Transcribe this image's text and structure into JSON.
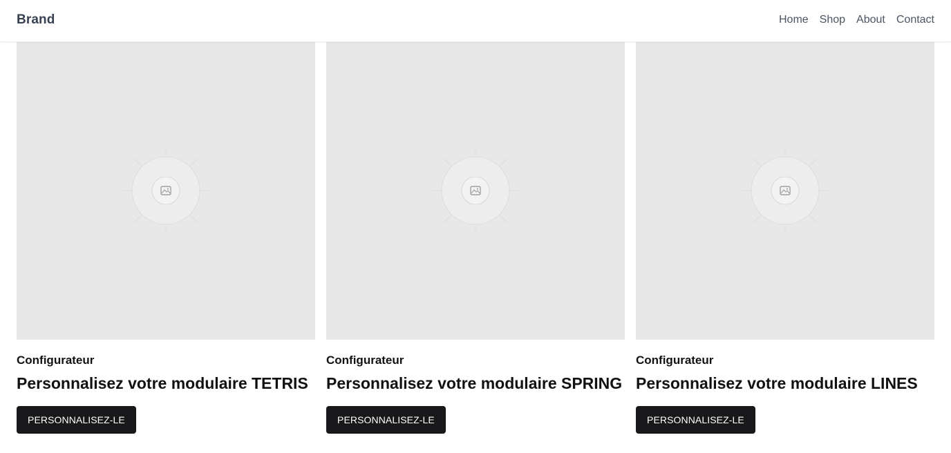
{
  "header": {
    "brand": "Brand",
    "nav": [
      "Home",
      "Shop",
      "About",
      "Contact"
    ]
  },
  "cards": [
    {
      "kicker": "Configurateur",
      "title": "Personnalisez votre modulaire TETRIS",
      "button": "PERSONNALISEZ-LE",
      "image_icon": "image-placeholder-icon"
    },
    {
      "kicker": "Configurateur",
      "title": "Personnalisez votre modulaire SPRING",
      "button": "PERSONNALISEZ-LE",
      "image_icon": "image-placeholder-icon"
    },
    {
      "kicker": "Configurateur",
      "title": "Personnalisez votre modulaire LINES",
      "button": "PERSONNALISEZ-LE",
      "image_icon": "image-placeholder-icon"
    }
  ],
  "colors": {
    "image_background": "#e8e8e8",
    "button_background": "#18181b",
    "button_text": "#ffffff",
    "nav_text": "#4b5563",
    "brand_text": "#374151"
  }
}
